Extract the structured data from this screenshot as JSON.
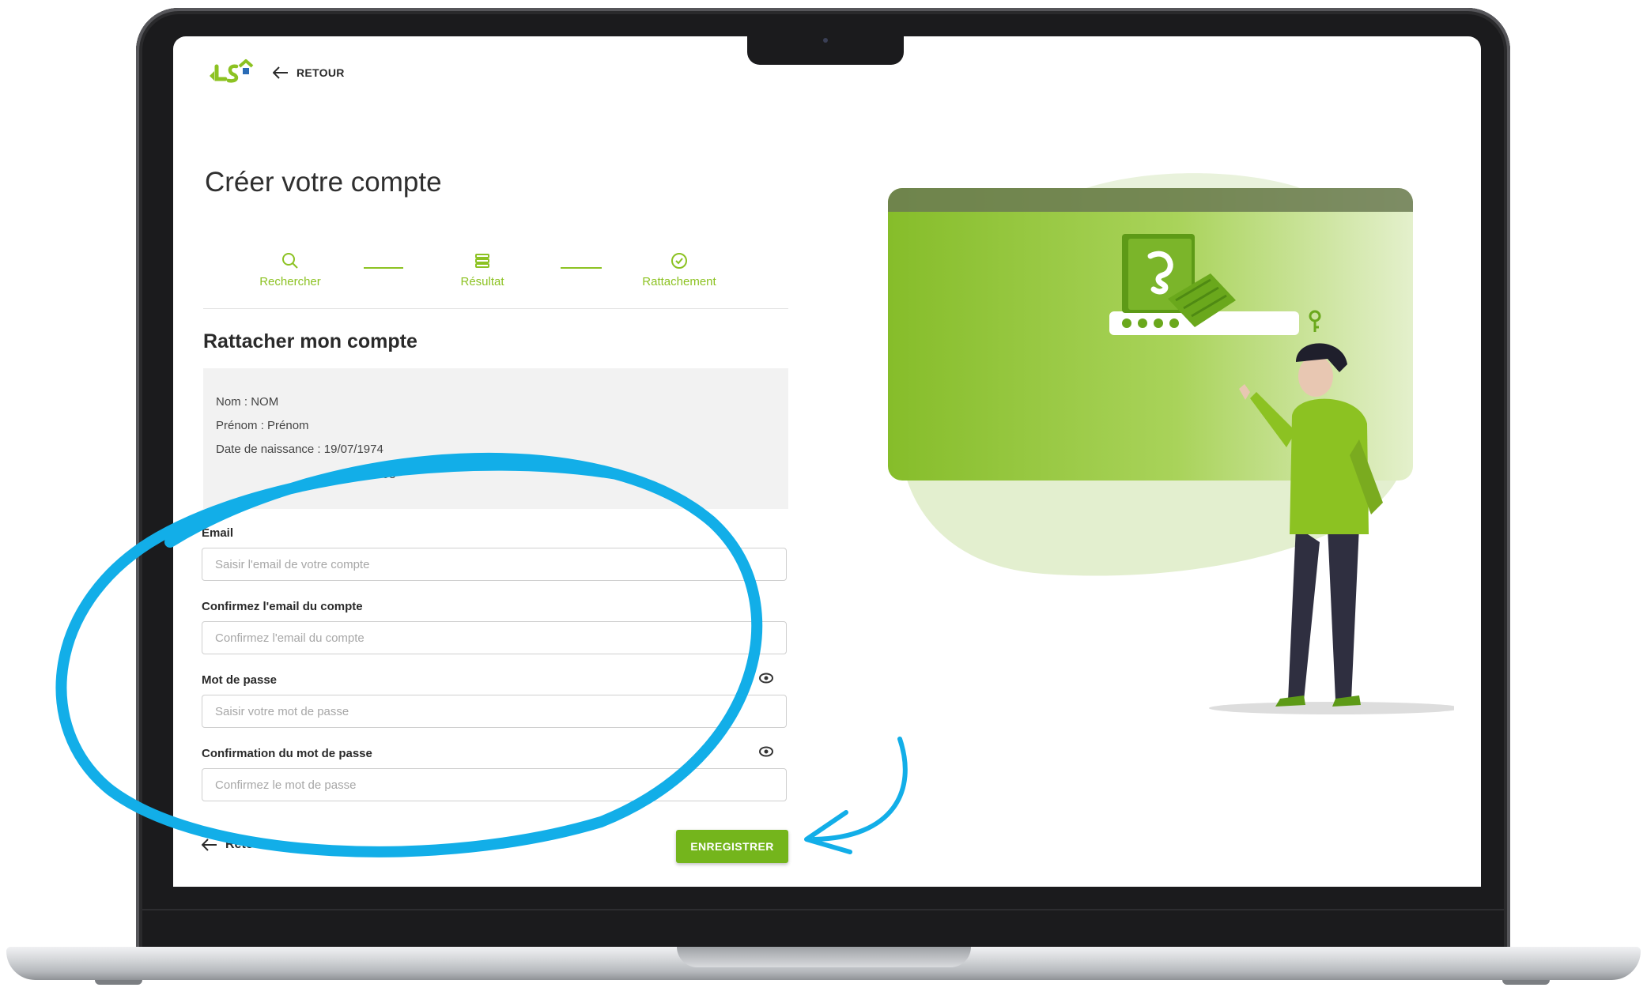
{
  "app": {
    "back_top_label": "RETOUR",
    "page_title": "Créer votre compte",
    "brand_color": "#8cc222",
    "button_color": "#74b51c"
  },
  "stepper": {
    "steps": [
      {
        "label": "Rechercher",
        "icon": "search-icon"
      },
      {
        "label": "Résultat",
        "icon": "list-icon"
      },
      {
        "label": "Rattachement",
        "icon": "check-circle-icon"
      }
    ]
  },
  "section_title": "Rattacher mon compte",
  "info": {
    "nom_label": "Nom :",
    "nom_value": "NOM",
    "prenom_label": "Prénom :",
    "prenom_value": "Prénom",
    "naissance_label": "Date de naissance :",
    "naissance_value": "19/07/1974",
    "numero_value": "0095898"
  },
  "form": {
    "email_label": "Email",
    "email_placeholder": "Saisir l'email de votre compte",
    "confirm_email_label": "Confirmez l'email du compte",
    "confirm_email_placeholder": "Confirmez l'email du compte",
    "password_label": "Mot de passe",
    "password_placeholder": "Saisir votre mot de passe",
    "confirm_password_label": "Confirmation du mot de passe",
    "confirm_password_placeholder": "Confirmez le mot de passe"
  },
  "footer": {
    "back_label": "Retour",
    "save_label": "ENREGISTRER"
  },
  "annotation": {
    "highlight_color": "#12aee8"
  }
}
